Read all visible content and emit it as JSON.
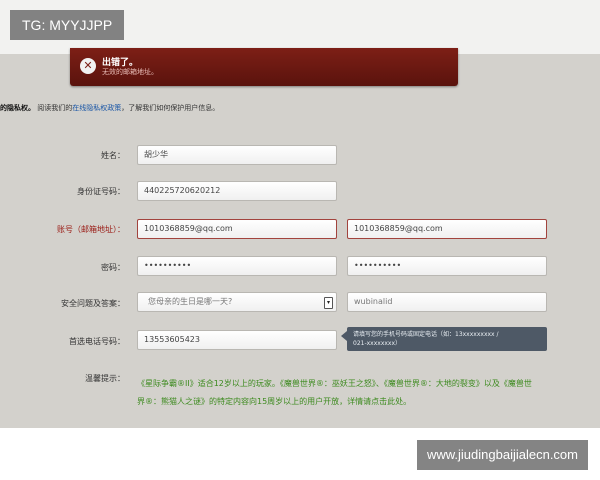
{
  "watermarks": {
    "top_left": "TG: MYYJJPP",
    "bottom_right": "www.jiudingbaijialecn.com"
  },
  "error": {
    "icon": "close-icon",
    "title": "出错了。",
    "message": "无效的邮箱地址。"
  },
  "privacy": {
    "lead": "的隐私权。",
    "before": "阅读我们的",
    "link": "在线隐私权政策",
    "after": "，了解我们如何保护用户信息。"
  },
  "form": {
    "name": {
      "label": "姓名：",
      "value": "胡少华"
    },
    "id_number": {
      "label": "身份证号码：",
      "value": "440225720620212"
    },
    "email": {
      "label": "账号（邮箱地址）：",
      "value": "1010368859@qq.com",
      "confirm_value": "1010368859@qq.com"
    },
    "password": {
      "label": "密码：",
      "value": "••••••••••",
      "confirm_value": "••••••••••"
    },
    "security": {
      "label": "安全问题及答案：",
      "question": "您母亲的生日是哪一天?",
      "dropdown_icon": "chevron-down-icon",
      "answer": "wubinalid"
    },
    "phone": {
      "label": "首选电话号码：",
      "value": "13553605423"
    },
    "phone_tooltip": {
      "line1": "请填写您的手机号码或固定电话（如：13xxxxxxxxx /",
      "line2": "021-xxxxxxxx）"
    },
    "notice": {
      "label": "温馨提示：",
      "text": "《星际争霸®II》适合12岁以上的玩家。《魔兽世界®：巫妖王之怒》、《魔兽世界®：大地的裂变》以及《魔兽世界®：熊猫人之谜》的特定内容向15周岁以上的用户开放，详情请点击此处。"
    }
  },
  "colors": {
    "error_banner": "#6b1810",
    "field_error_label": "#9a1a14",
    "notice_text": "#3c8a1e",
    "link": "#1a56a6"
  }
}
